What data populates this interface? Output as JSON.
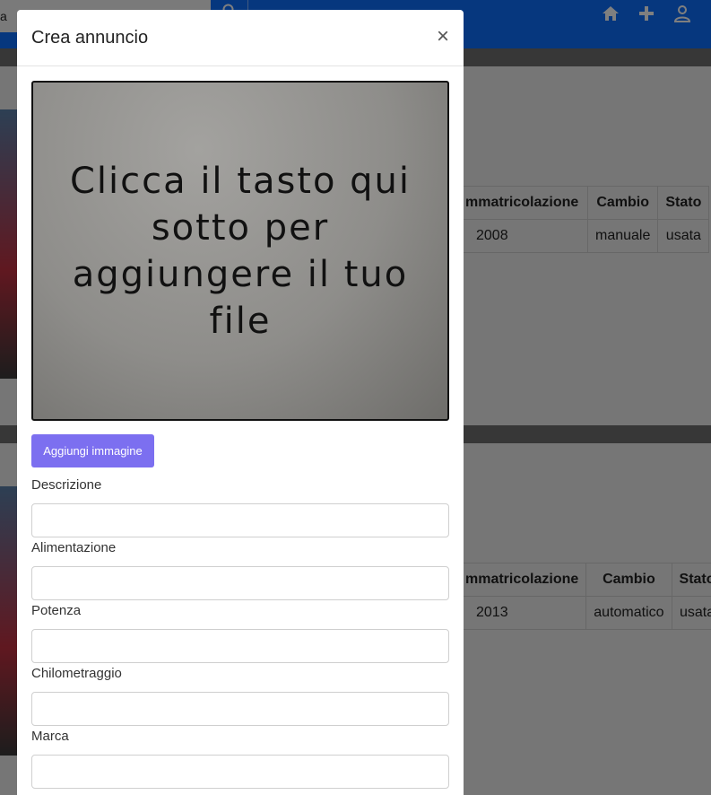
{
  "navbar": {
    "left_text": "a"
  },
  "listings": [
    {
      "headers": [
        "mmatricolazione",
        "Cambio",
        "Stato"
      ],
      "row": [
        "2008",
        "manuale",
        "usata"
      ]
    },
    {
      "headers": [
        "mmatricolazione",
        "Cambio",
        "Stato"
      ],
      "row": [
        "2013",
        "automatico",
        "usata"
      ]
    }
  ],
  "modal": {
    "title": "Crea annuncio",
    "close_label": "×",
    "preview_text": "Clicca il tasto qui sotto per aggiungere il tuo file",
    "add_image_label": "Aggiungi immagine",
    "fields": [
      {
        "label": "Descrizione",
        "value": ""
      },
      {
        "label": "Alimentazione",
        "value": ""
      },
      {
        "label": "Potenza",
        "value": ""
      },
      {
        "label": "Chilometraggio",
        "value": ""
      },
      {
        "label": "Marca",
        "value": ""
      }
    ]
  },
  "colors": {
    "navbar": "#0d6efd",
    "button": "#7c6ff0"
  }
}
